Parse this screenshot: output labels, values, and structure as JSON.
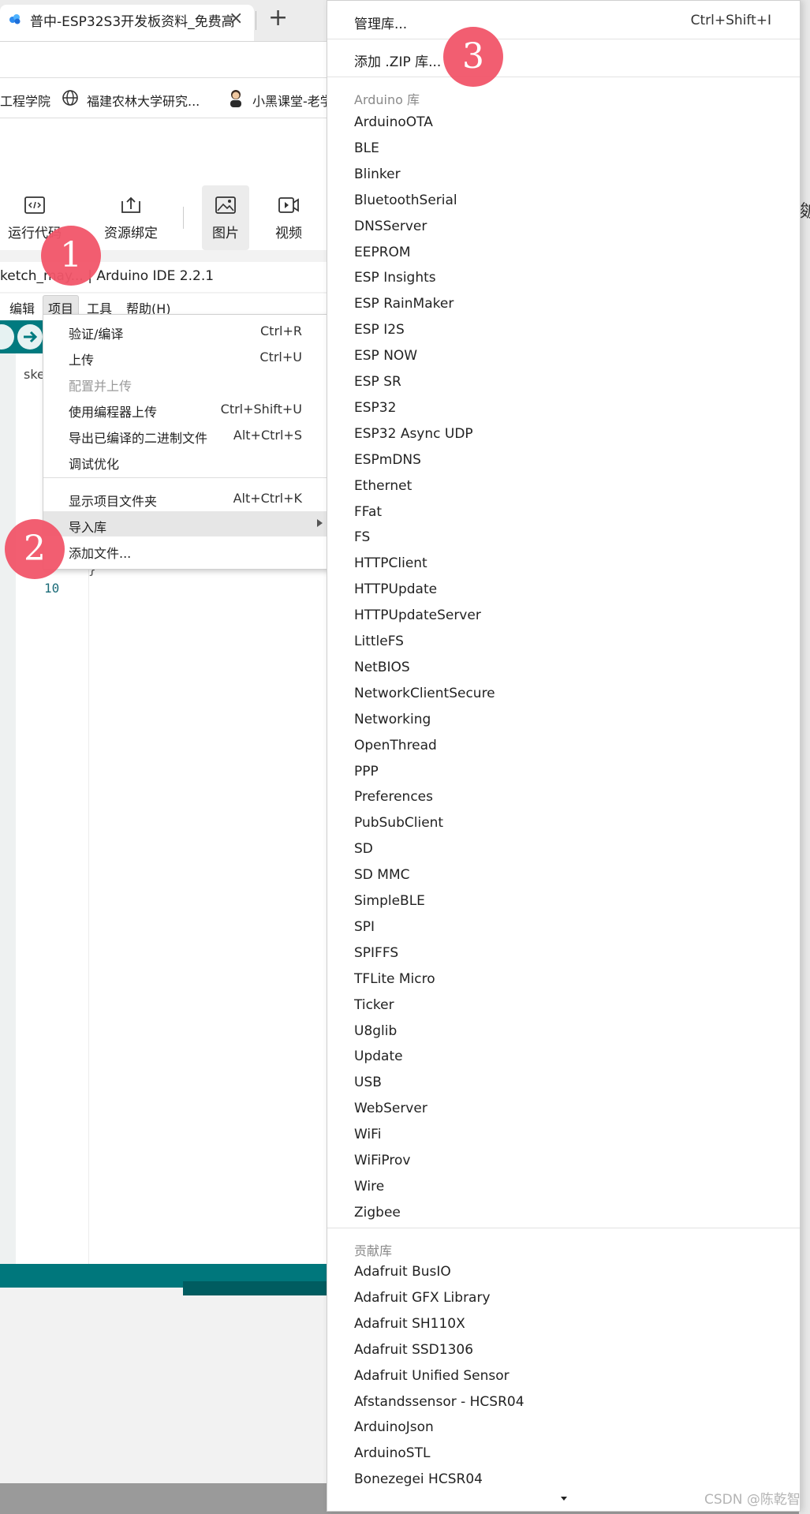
{
  "browser": {
    "tab_title": "普中-ESP32S3开发板资料_免费高",
    "tab_close": "×",
    "new_tab": "+",
    "bookmarks": [
      "工程学院",
      "福建农林大学研究...",
      "小黑课堂-老学"
    ]
  },
  "page_toolbar": {
    "items": [
      {
        "label": "运行代码",
        "icon": "code-icon"
      },
      {
        "label": "资源绑定",
        "icon": "upload-icon"
      },
      {
        "label": "图片",
        "icon": "image-icon"
      },
      {
        "label": "视频",
        "icon": "video-icon"
      }
    ],
    "edge_label": "皴"
  },
  "ide": {
    "title": "ketch_may...  | Arduino IDE 2.2.1",
    "menubar": [
      "编辑",
      "项目",
      "工具",
      "帮助(H)"
    ],
    "file_tab": "ske",
    "line_number": "10",
    "brace": "}"
  },
  "project_menu": {
    "items": [
      {
        "label": "验证/编译",
        "shortcut": "Ctrl+R",
        "disabled": false
      },
      {
        "label": "上传",
        "shortcut": "Ctrl+U",
        "disabled": false
      },
      {
        "label": "配置并上传",
        "shortcut": "",
        "disabled": true
      },
      {
        "label": "使用编程器上传",
        "shortcut": "Ctrl+Shift+U",
        "disabled": false
      },
      {
        "label": "导出已编译的二进制文件",
        "shortcut": "Alt+Ctrl+S",
        "disabled": false
      },
      {
        "label": "调试优化",
        "shortcut": "",
        "disabled": false
      },
      {
        "label": "显示项目文件夹",
        "shortcut": "Alt+Ctrl+K",
        "disabled": false
      },
      {
        "label": "导入库",
        "shortcut": "",
        "disabled": false,
        "highlighted": true,
        "submenu": true
      },
      {
        "label": "添加文件...",
        "shortcut": "",
        "disabled": false
      }
    ]
  },
  "library_menu": {
    "manage_label": "管理库...",
    "manage_shortcut": "Ctrl+Shift+I",
    "add_zip_label": "添加 .ZIP 库...",
    "arduino_header": "Arduino 库",
    "arduino_libs": [
      "ArduinoOTA",
      "BLE",
      "Blinker",
      "BluetoothSerial",
      "DNSServer",
      "EEPROM",
      "ESP Insights",
      "ESP RainMaker",
      "ESP I2S",
      "ESP NOW",
      "ESP SR",
      "ESP32",
      "ESP32 Async UDP",
      "ESPmDNS",
      "Ethernet",
      "FFat",
      "FS",
      "HTTPClient",
      "HTTPUpdate",
      "HTTPUpdateServer",
      "LittleFS",
      "NetBIOS",
      "NetworkClientSecure",
      "Networking",
      "OpenThread",
      "PPP",
      "Preferences",
      "PubSubClient",
      "SD",
      "SD MMC",
      "SimpleBLE",
      "SPI",
      "SPIFFS",
      "TFLite Micro",
      "Ticker",
      "U8glib",
      "Update",
      "USB",
      "WebServer",
      "WiFi",
      "WiFiProv",
      "Wire",
      "Zigbee"
    ],
    "contributed_header": "贡献库",
    "contributed_libs": [
      "Adafruit BusIO",
      "Adafruit GFX Library",
      "Adafruit SH110X",
      "Adafruit SSD1306",
      "Adafruit Unified Sensor",
      "Afstandssensor - HCSR04",
      "ArduinoJson",
      "ArduinoSTL",
      "Bonezegei HCSR04"
    ]
  },
  "callouts": [
    "1",
    "2",
    "3"
  ],
  "watermark": "CSDN @陈乾智",
  "colors": {
    "ide_teal": "#007a7f",
    "callout": "#f2566a",
    "highlight": "#e6e6e6"
  }
}
